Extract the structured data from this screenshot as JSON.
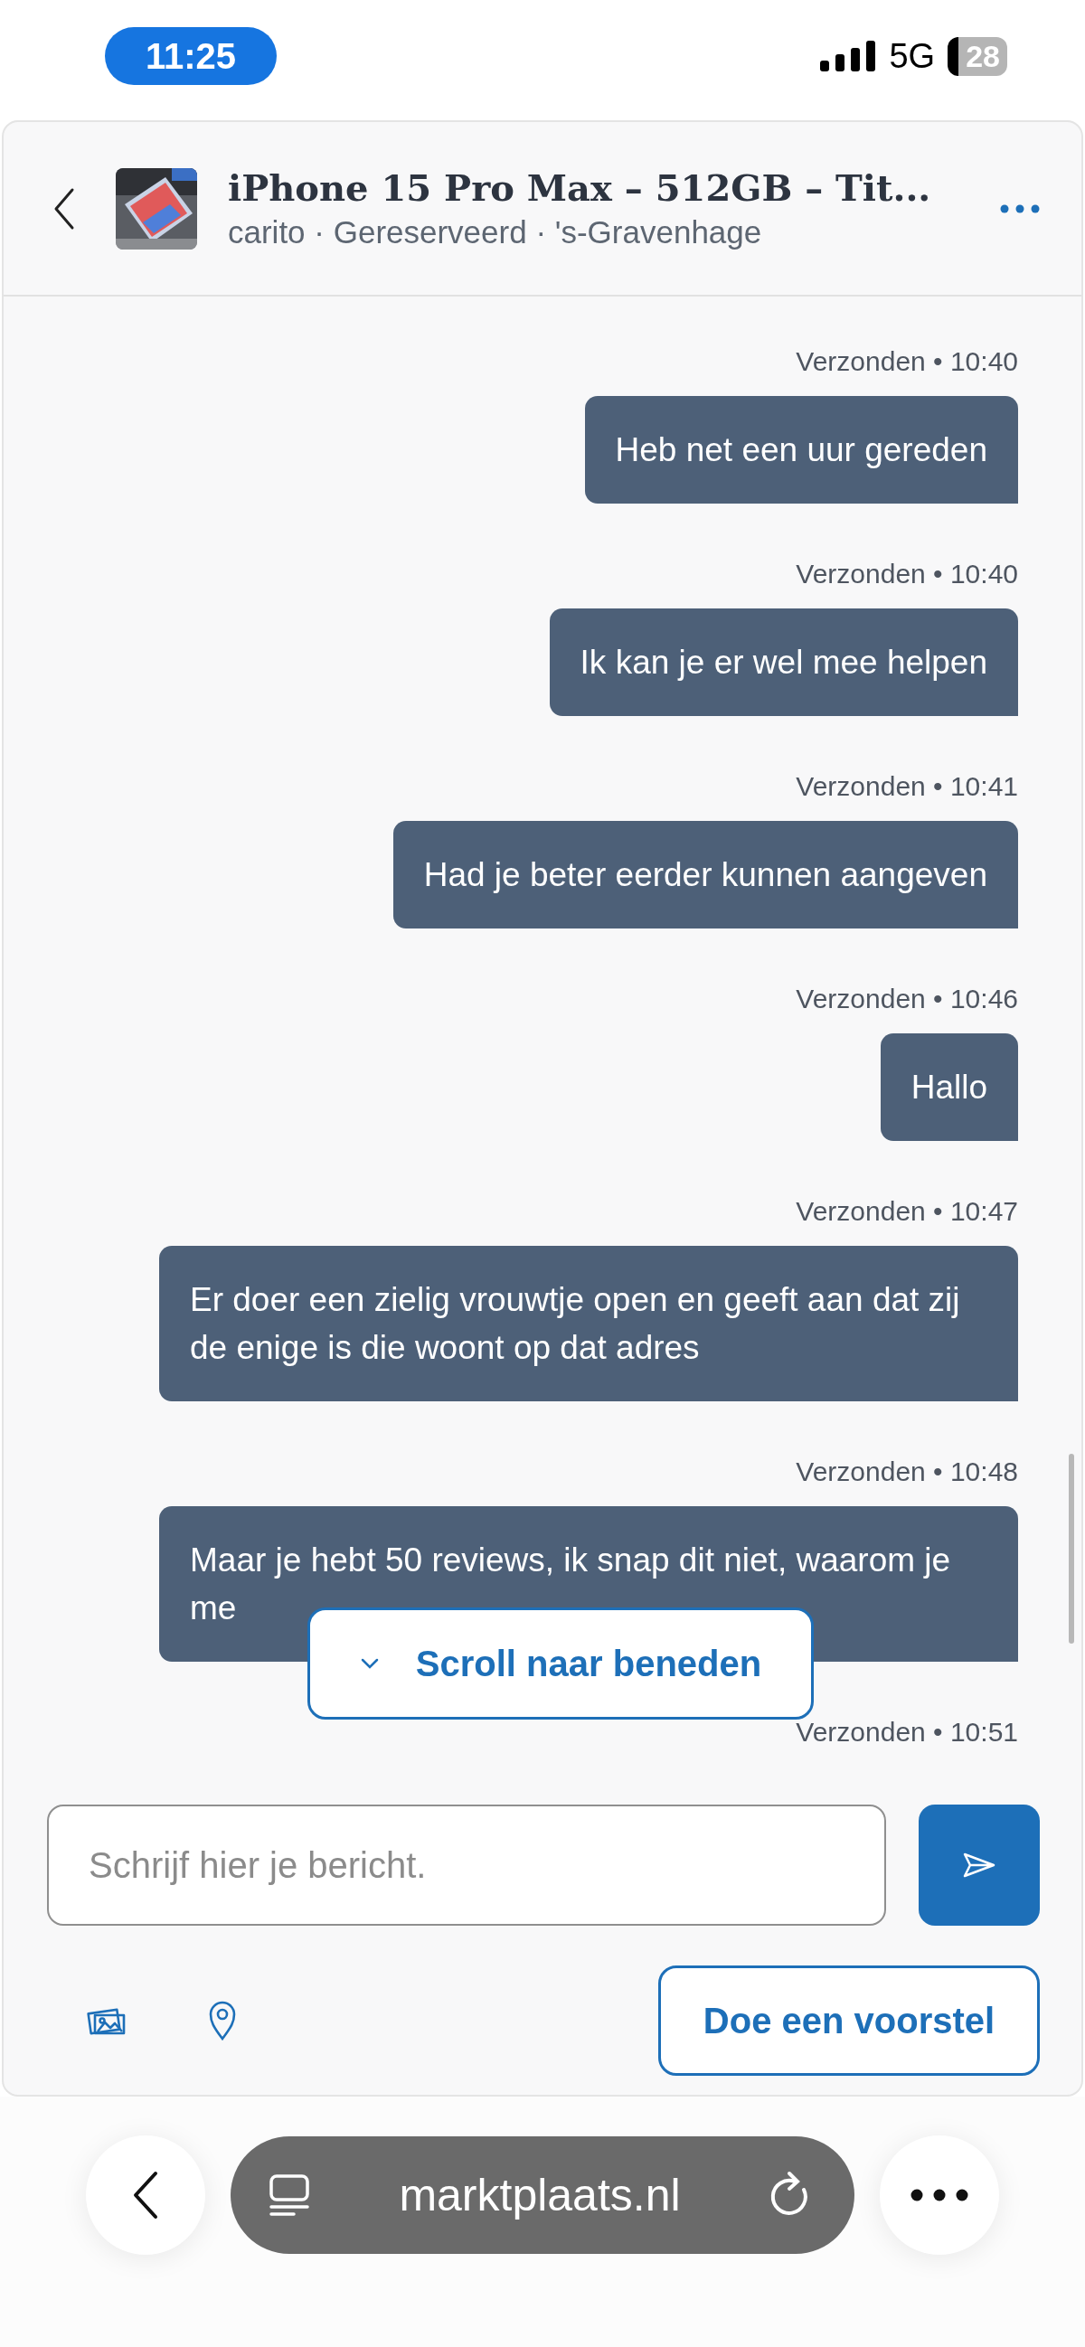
{
  "status_bar": {
    "time": "11:25",
    "network": "5G",
    "battery": "28"
  },
  "header": {
    "title": "iPhone 15 Pro Max – 512GB – Tit...",
    "subtitle": "carito · Gereserveerd · 's-Gravenhage"
  },
  "messages": [
    {
      "meta": "Verzonden • 10:40",
      "text": "Heb net een uur gereden"
    },
    {
      "meta": "Verzonden • 10:40",
      "text": "Ik kan je er wel mee helpen"
    },
    {
      "meta": "Verzonden • 10:41",
      "text": "Had je beter eerder kunnen aangeven"
    },
    {
      "meta": "Verzonden • 10:46",
      "text": "Hallo"
    },
    {
      "meta": "Verzonden • 10:47",
      "text": "Er doer een zielig vrouwtje open en geeft aan dat zij de enige is die woont op dat adres"
    },
    {
      "meta": "Verzonden • 10:48",
      "text": "Maar je hebt 50 reviews, ik snap dit niet, waarom je me"
    },
    {
      "meta": "Verzonden • 10:51"
    }
  ],
  "scroll_button": "Scroll naar beneden",
  "composer": {
    "placeholder": "Schrijf hier je bericht.",
    "offer_button": "Doe een voorstel"
  },
  "browser": {
    "url": "marktplaats.nl"
  }
}
